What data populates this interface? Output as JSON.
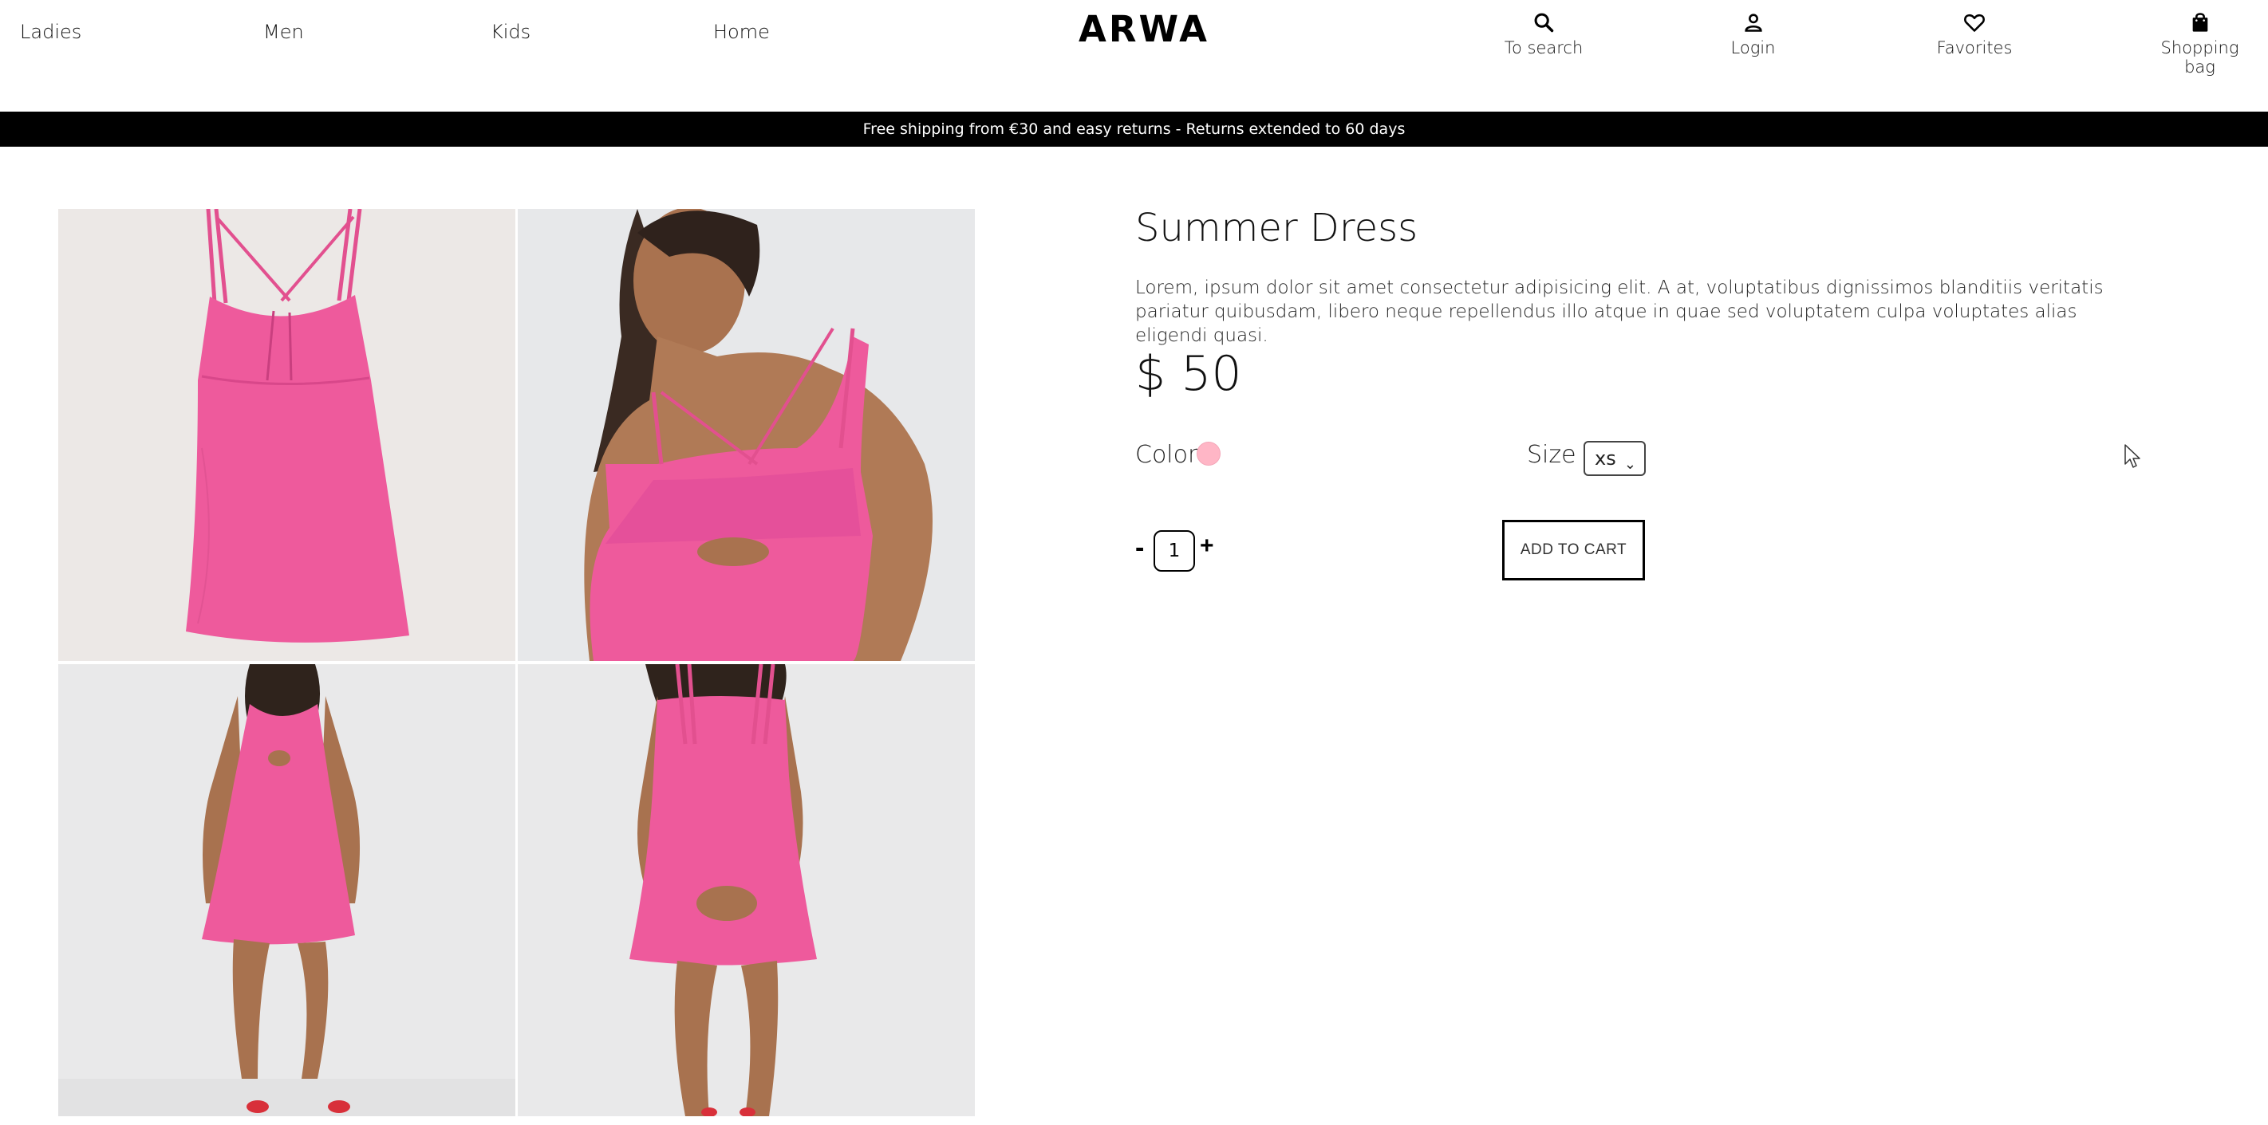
{
  "brand": {
    "logo_text": "ARWA"
  },
  "nav_left": [
    {
      "label": "Ladies"
    },
    {
      "label": "Men"
    },
    {
      "label": "Kids"
    },
    {
      "label": "Home"
    }
  ],
  "nav_right": [
    {
      "label": "To search",
      "icon": "search-icon"
    },
    {
      "label": "Login",
      "icon": "user-icon"
    },
    {
      "label": "Favorites",
      "icon": "heart-icon"
    },
    {
      "label": "Shopping bag",
      "icon": "shopping-bag-icon"
    }
  ],
  "announcement": "Free shipping from €30 and easy returns - Returns extended to 60 days",
  "product": {
    "title": "Summer Dress",
    "description": "Lorem, ipsum dolor sit amet consectetur adipisicing elit. A at, voluptatibus dignissimos blanditiis veritatis pariatur quibusdam, libero neque repellendus illo atque in quae sed voluptatem culpa voluptates alias eligendi quasi.",
    "price": "$ 50",
    "color_label": "Color",
    "color_value": "#ffb6c6",
    "size_label": "Size",
    "size_selected": "xs",
    "quantity": "1",
    "qty_minus": "-",
    "qty_plus": "+",
    "add_to_cart": "ADD TO CART"
  },
  "gallery": [
    {
      "icon": "dress-flat-image"
    },
    {
      "icon": "model-closeup-image"
    },
    {
      "icon": "model-front-image"
    },
    {
      "icon": "model-back-image"
    }
  ],
  "colors": {
    "dress": "#ef5a9b",
    "announce_bg": "#000000"
  }
}
